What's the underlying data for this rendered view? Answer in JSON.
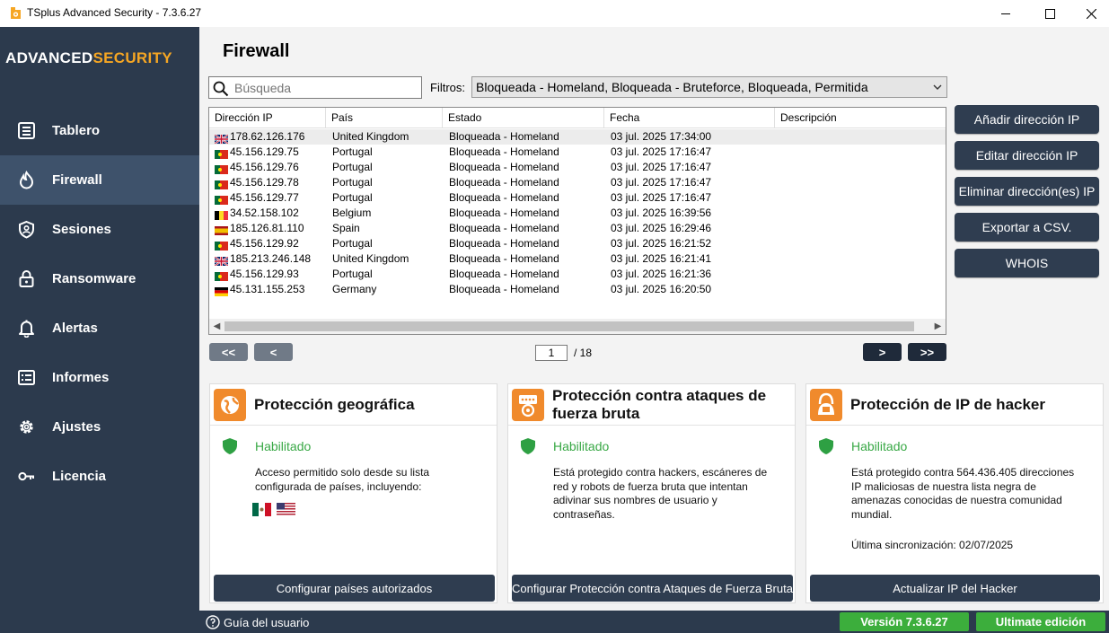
{
  "window": {
    "title": "TSplus Advanced Security - 7.3.6.27"
  },
  "logo": {
    "part1": "ADVANCED",
    "part2": "SECURITY"
  },
  "sidebar": {
    "items": [
      {
        "label": "Tablero",
        "icon": "dashboard-icon"
      },
      {
        "label": "Firewall",
        "icon": "flame-icon"
      },
      {
        "label": "Sesiones",
        "icon": "shield-icon"
      },
      {
        "label": "Ransomware",
        "icon": "lock-icon"
      },
      {
        "label": "Alertas",
        "icon": "bell-icon"
      },
      {
        "label": "Informes",
        "icon": "report-icon"
      },
      {
        "label": "Ajustes",
        "icon": "gear-icon"
      },
      {
        "label": "Licencia",
        "icon": "key-icon"
      }
    ]
  },
  "page": {
    "title": "Firewall"
  },
  "search": {
    "placeholder": "Búsqueda"
  },
  "filter": {
    "label": "Filtros:",
    "value": "Bloqueada - Homeland, Bloqueada - Bruteforce, Bloqueada, Permitida"
  },
  "table": {
    "columns": [
      "Dirección IP",
      "País",
      "Estado",
      "Fecha",
      "Descripción"
    ],
    "rows": [
      {
        "flag": "gb",
        "ip": "178.62.126.176",
        "country": "United Kingdom",
        "state": "Bloqueada - Homeland",
        "date": "03 jul. 2025 17:34:00",
        "desc": ""
      },
      {
        "flag": "pt",
        "ip": "45.156.129.75",
        "country": "Portugal",
        "state": "Bloqueada - Homeland",
        "date": "03 jul. 2025 17:16:47",
        "desc": ""
      },
      {
        "flag": "pt",
        "ip": "45.156.129.76",
        "country": "Portugal",
        "state": "Bloqueada - Homeland",
        "date": "03 jul. 2025 17:16:47",
        "desc": ""
      },
      {
        "flag": "pt",
        "ip": "45.156.129.78",
        "country": "Portugal",
        "state": "Bloqueada - Homeland",
        "date": "03 jul. 2025 17:16:47",
        "desc": ""
      },
      {
        "flag": "pt",
        "ip": "45.156.129.77",
        "country": "Portugal",
        "state": "Bloqueada - Homeland",
        "date": "03 jul. 2025 17:16:47",
        "desc": ""
      },
      {
        "flag": "be",
        "ip": "34.52.158.102",
        "country": "Belgium",
        "state": "Bloqueada - Homeland",
        "date": "03 jul. 2025 16:39:56",
        "desc": ""
      },
      {
        "flag": "es",
        "ip": "185.126.81.110",
        "country": "Spain",
        "state": "Bloqueada - Homeland",
        "date": "03 jul. 2025 16:29:46",
        "desc": ""
      },
      {
        "flag": "pt",
        "ip": "45.156.129.92",
        "country": "Portugal",
        "state": "Bloqueada - Homeland",
        "date": "03 jul. 2025 16:21:52",
        "desc": ""
      },
      {
        "flag": "gb",
        "ip": "185.213.246.148",
        "country": "United Kingdom",
        "state": "Bloqueada - Homeland",
        "date": "03 jul. 2025 16:21:41",
        "desc": ""
      },
      {
        "flag": "pt",
        "ip": "45.156.129.93",
        "country": "Portugal",
        "state": "Bloqueada - Homeland",
        "date": "03 jul. 2025 16:21:36",
        "desc": ""
      },
      {
        "flag": "de",
        "ip": "45.131.155.253",
        "country": "Germany",
        "state": "Bloqueada - Homeland",
        "date": "03 jul. 2025 16:20:50",
        "desc": ""
      }
    ]
  },
  "pagination": {
    "first": "<<",
    "prev": "<",
    "current": "1",
    "total": "/ 18",
    "next": ">",
    "last": ">>"
  },
  "actions": [
    "Añadir dirección IP",
    "Editar dirección IP",
    "Eliminar dirección(es) IP",
    "Exportar a CSV.",
    "WHOIS"
  ],
  "cards": {
    "geo": {
      "title": "Protección geográfica",
      "status": "Habilitado",
      "description": "Acceso permitido solo desde su lista configurada de países, incluyendo:",
      "flags": [
        "mx",
        "us"
      ],
      "button": "Configurar países autorizados"
    },
    "brute": {
      "title": "Protección contra ataques de fuerza bruta",
      "status": "Habilitado",
      "description": "Está protegido contra hackers, escáneres de red y robots de fuerza bruta que intentan adivinar sus nombres de usuario y contraseñas.",
      "button": "Configurar Protección contra Ataques de Fuerza Bruta"
    },
    "hacker": {
      "title": "Protección de IP de hacker",
      "status": "Habilitado",
      "description": "Está protegido contra 564.436.405 direcciones IP maliciosas de nuestra lista negra de amenazas conocidas de nuestra comunidad mundial.",
      "sync": "Última sincronización: 02/07/2025",
      "button": "Actualizar IP del Hacker"
    }
  },
  "footer": {
    "guide": "Guía del usuario",
    "version": "Versión 7.3.6.27",
    "edition": "Ultimate edición"
  },
  "colors": {
    "sidebar": "#2c3a4d",
    "accent": "#f6a623",
    "enabled": "#38a845",
    "badge": "#3cae3c"
  }
}
